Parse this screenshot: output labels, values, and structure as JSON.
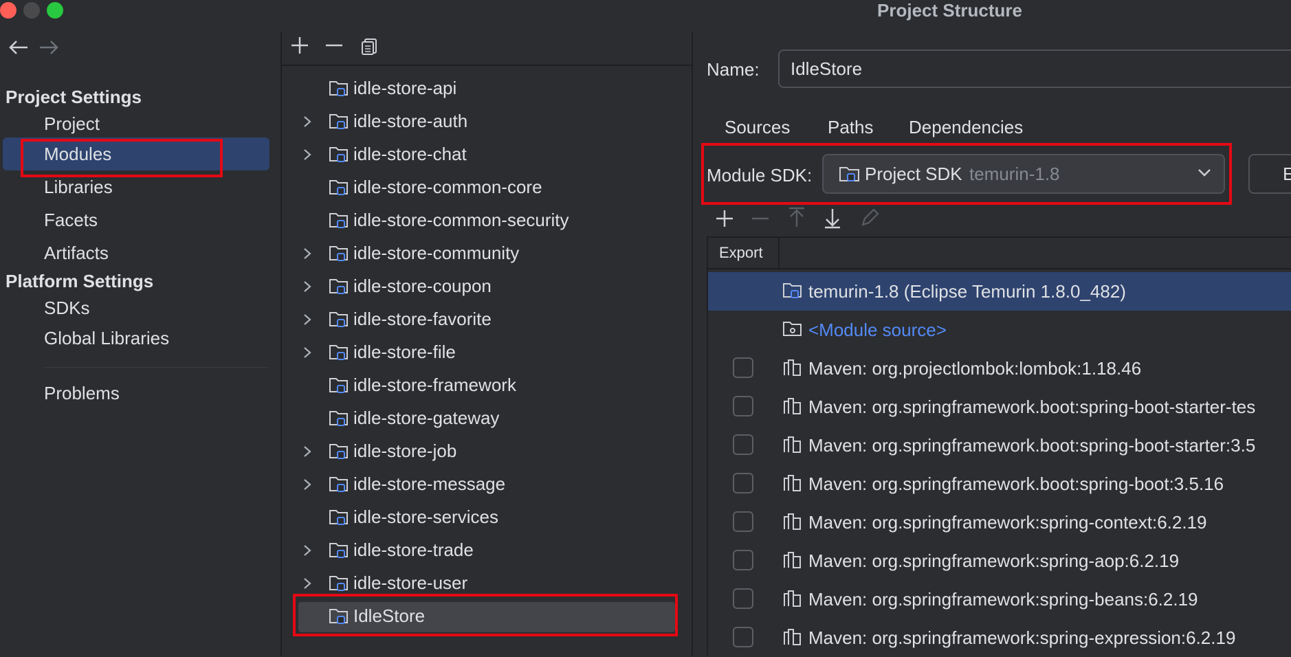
{
  "window": {
    "title": "Project Structure",
    "traffic_lights": {
      "close": "#ff5f57",
      "minimize": "#4a4a4c",
      "maximize": "#28c840"
    }
  },
  "sidebar": {
    "project_settings_header": "Project Settings",
    "project_items": [
      "Project",
      "Modules",
      "Libraries",
      "Facets",
      "Artifacts"
    ],
    "selected_item": "Modules",
    "platform_settings_header": "Platform Settings",
    "platform_items": [
      "SDKs",
      "Global Libraries"
    ],
    "problems": "Problems"
  },
  "modules_tree": {
    "items": [
      {
        "label": "idle-store-api",
        "expandable": false
      },
      {
        "label": "idle-store-auth",
        "expandable": true
      },
      {
        "label": "idle-store-chat",
        "expandable": true
      },
      {
        "label": "idle-store-common-core",
        "expandable": false
      },
      {
        "label": "idle-store-common-security",
        "expandable": false
      },
      {
        "label": "idle-store-community",
        "expandable": true
      },
      {
        "label": "idle-store-coupon",
        "expandable": true
      },
      {
        "label": "idle-store-favorite",
        "expandable": true
      },
      {
        "label": "idle-store-file",
        "expandable": true
      },
      {
        "label": "idle-store-framework",
        "expandable": false
      },
      {
        "label": "idle-store-gateway",
        "expandable": false
      },
      {
        "label": "idle-store-job",
        "expandable": true
      },
      {
        "label": "idle-store-message",
        "expandable": true
      },
      {
        "label": "idle-store-services",
        "expandable": false
      },
      {
        "label": "idle-store-trade",
        "expandable": true
      },
      {
        "label": "idle-store-user",
        "expandable": true
      },
      {
        "label": "IdleStore",
        "expandable": false,
        "selected": true
      }
    ]
  },
  "details": {
    "name_label": "Name:",
    "name_value": "IdleStore",
    "tabs": [
      "Sources",
      "Paths",
      "Dependencies"
    ],
    "active_tab": "Dependencies",
    "module_sdk_label": "Module SDK:",
    "sdk_main": "Project SDK",
    "sdk_sub": "temurin-1.8",
    "edit_button_label": "E",
    "export_header": "Export",
    "dependencies": [
      {
        "label": "temurin-1.8 (Eclipse Temurin 1.8.0_482)",
        "type": "sdk",
        "selected": true
      },
      {
        "label": "<Module source>",
        "type": "source",
        "link": true
      },
      {
        "label": "Maven: org.projectlombok:lombok:1.18.46",
        "type": "library"
      },
      {
        "label": "Maven: org.springframework.boot:spring-boot-starter-tes",
        "type": "library"
      },
      {
        "label": "Maven: org.springframework.boot:spring-boot-starter:3.5",
        "type": "library"
      },
      {
        "label": "Maven: org.springframework.boot:spring-boot:3.5.16",
        "type": "library"
      },
      {
        "label": "Maven: org.springframework:spring-context:6.2.19",
        "type": "library"
      },
      {
        "label": "Maven: org.springframework:spring-aop:6.2.19",
        "type": "library"
      },
      {
        "label": "Maven: org.springframework:spring-beans:6.2.19",
        "type": "library"
      },
      {
        "label": "Maven: org.springframework:spring-expression:6.2.19",
        "type": "library"
      }
    ]
  },
  "colors": {
    "accent": "#3574f0",
    "selection": "#2e436e",
    "highlight_box": "#e50914",
    "link": "#548af7"
  }
}
